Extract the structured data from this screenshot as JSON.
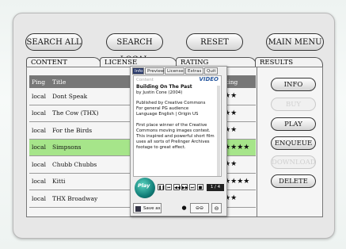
{
  "top_buttons": {
    "search_all": "SEARCH ALL",
    "search_local": "SEARCH LOCAL",
    "reset": "RESET",
    "main_menu": "MAIN MENU"
  },
  "tabs": {
    "content": "CONTENT",
    "license": "LICENSE",
    "rating": "RATING",
    "results": "RESULTS"
  },
  "table": {
    "headers": {
      "ping": "Ping",
      "title": "Title",
      "rating": "Rating"
    },
    "rows": [
      {
        "ping": "local",
        "title": "Dont Speak",
        "rating": "★★★"
      },
      {
        "ping": "local",
        "title": "The Cow (THX)",
        "rating": "★★★"
      },
      {
        "ping": "local",
        "title": "For the Birds",
        "rating": "★★★"
      },
      {
        "ping": "local",
        "title": "Simpsons",
        "rating": "★★★★★",
        "selected": true
      },
      {
        "ping": "local",
        "title": "Chubb Chubbs",
        "rating": "★★★"
      },
      {
        "ping": "local",
        "title": "Kitti",
        "rating": "★★★★★"
      },
      {
        "ping": "local",
        "title": "THX Broadway",
        "rating": "★★★"
      }
    ]
  },
  "results_buttons": {
    "info": "INFO",
    "buy": "BUY",
    "play": "PLAY",
    "enqueue": "ENQUEUE",
    "download": "DOWNLOAD",
    "delete": "DELETE"
  },
  "popup": {
    "tabs": [
      "Info",
      "Preview",
      "License",
      "Extras",
      "Quit"
    ],
    "header": "Content",
    "logo": "VIDEO",
    "title": "Building On The Past",
    "byline": "by Justin Cone (2004)",
    "lines1": [
      "Published by Creative Commons",
      "For general PG audience",
      "Language English | Origin US"
    ],
    "lines2": [
      "First place winner of the Creative",
      "Commons moving images contest.",
      "This inspired and powerful short film",
      "uses all sorts of Prelinger Archives",
      "footage to great effect."
    ],
    "play_logo": "Play",
    "counter": "1 / 4",
    "save_as": "Save as"
  },
  "colors": {
    "selected_row": "#a6e58a",
    "header_bg": "#777777",
    "popup_active_tab": "#2a3a6b"
  }
}
